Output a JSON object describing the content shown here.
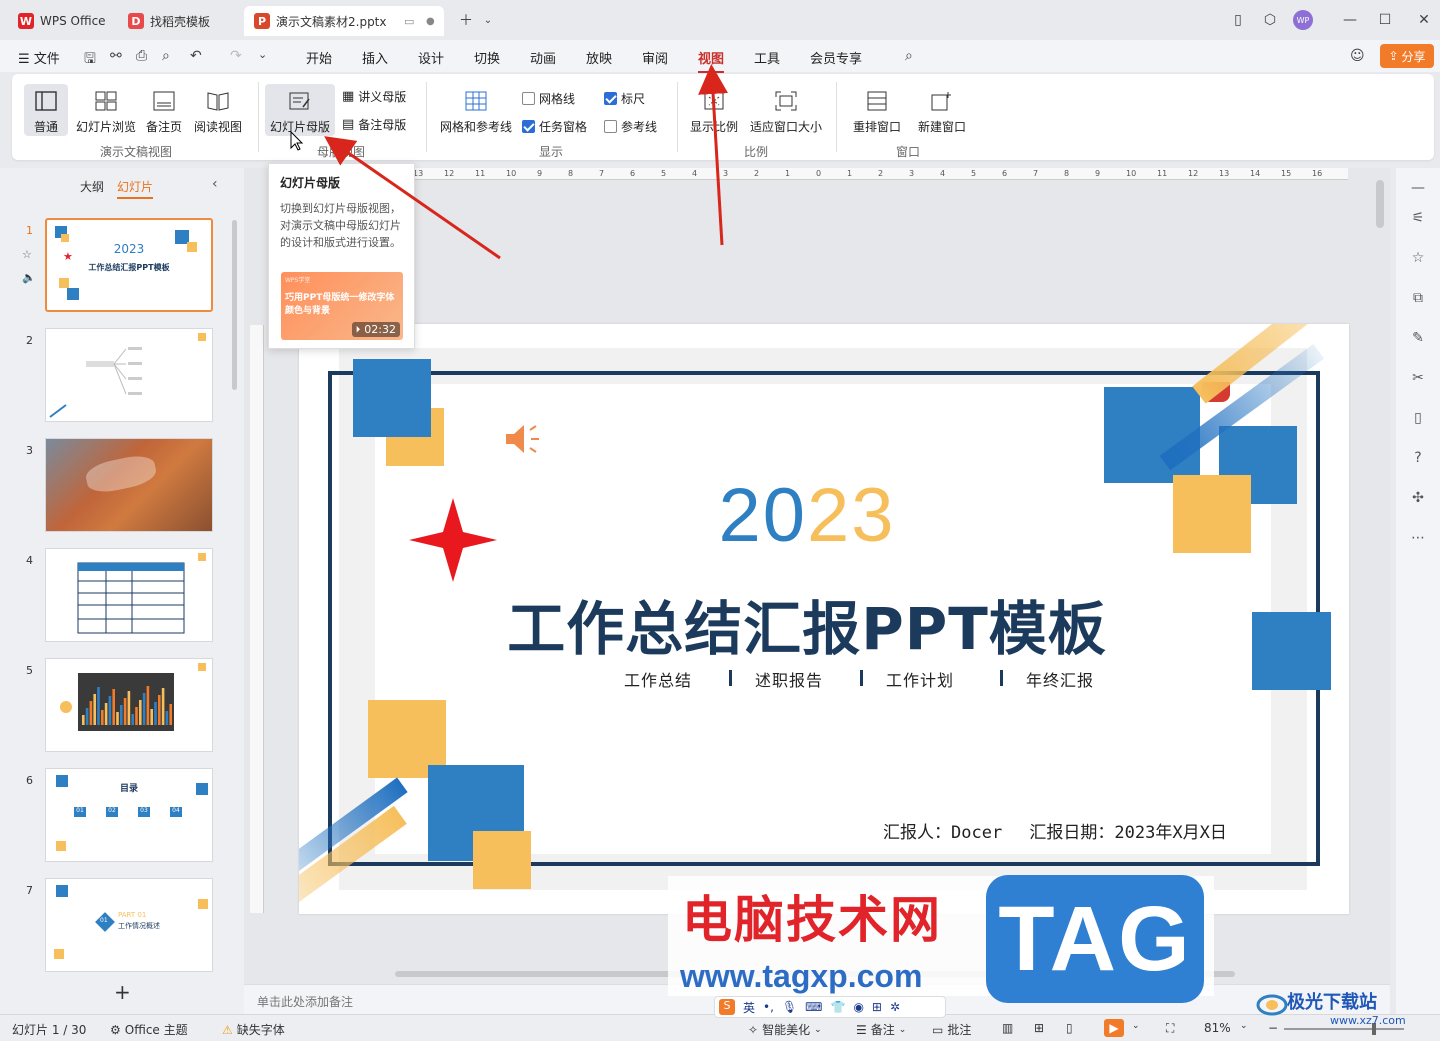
{
  "tabs": [
    {
      "label": "WPS Office",
      "logo": "W"
    },
    {
      "label": "找稻壳模板",
      "logo": "D"
    },
    {
      "label": "演示文稿素材2.pptx",
      "logo": "P"
    }
  ],
  "menu": {
    "file": "文件",
    "items": [
      "开始",
      "插入",
      "设计",
      "切换",
      "动画",
      "放映",
      "审阅",
      "视图",
      "工具",
      "会员专享"
    ],
    "active": "视图",
    "share": "分享"
  },
  "avatar": "WP",
  "ribbon": {
    "groups": {
      "presentation_views": "演示文稿视图",
      "master_views": "母版视图",
      "show": "显示",
      "zoom": "比例",
      "window": "窗口"
    },
    "buttons": {
      "normal": "普通",
      "slide_sorter": "幻灯片浏览",
      "notes_page": "备注页",
      "reading_view": "阅读视图",
      "slide_master": "幻灯片母版",
      "handout_master": "讲义母版",
      "notes_master": "备注母版",
      "grid_guides": "网格和参考线",
      "gridlines": "网格线",
      "ruler": "标尺",
      "task_pane": "任务窗格",
      "guides": "参考线",
      "zoom": "显示比例",
      "fit_window": "适应窗口大小",
      "arrange_window": "重排窗口",
      "new_window": "新建窗口"
    }
  },
  "tooltip": {
    "title": "幻灯片母版",
    "body": "切换到幻灯片母版视图，对演示文稿中母版幻灯片的设计和版式进行设置。",
    "video_brand": "WPS学堂",
    "video_title": "巧用PPT母版统一修改字体颜色与背景",
    "video_duration": "02:32"
  },
  "left_panel": {
    "tab_outline": "大纲",
    "tab_slides": "幻灯片",
    "slide_numbers": [
      "1",
      "2",
      "3",
      "4",
      "5",
      "6",
      "7"
    ],
    "thumb1_year": "2023",
    "thumb1_title": "工作总结汇报PPT模板",
    "thumb6_title": "目录",
    "thumb6_nums": [
      "01",
      "02",
      "03",
      "04"
    ],
    "thumb7_part": "PART 01",
    "thumb7_title": "工作情况概述",
    "thumb7_num": "01"
  },
  "ruler_labels": [
    "13",
    "12",
    "11",
    "10",
    "9",
    "8",
    "7",
    "6",
    "5",
    "4",
    "3",
    "2",
    "1",
    "0",
    "1",
    "2",
    "3",
    "4",
    "5",
    "6",
    "7",
    "8",
    "9",
    "10",
    "11",
    "12",
    "13",
    "14",
    "15",
    "16"
  ],
  "slide": {
    "year_a": "20",
    "year_b": "23",
    "title": "工作总结汇报PPT模板",
    "subtitles": [
      "工作总结",
      "述职报告",
      "工作计划",
      "年终汇报"
    ],
    "reporter": "汇报人：Docer　 汇报日期：2023年X月X日"
  },
  "notes_placeholder": "单击此处添加备注",
  "status": {
    "slide_counter": "幻灯片 1 / 30",
    "theme": "Office 主题",
    "missing_font": "缺失字体",
    "beautify": "智能美化",
    "notes": "备注",
    "comments": "批注",
    "zoom": "81%"
  },
  "watermark": {
    "text": "电脑技术网",
    "url": "www.tagxp.com",
    "tag": "TAG",
    "site2": "极光下载站",
    "site2_url": "www.xz7.com"
  },
  "colors": {
    "accent_red": "#c9302c",
    "blue": "#2f7fc3",
    "yellow": "#f6bf5c",
    "navy": "#1b3a5c",
    "orange": "#f27b2a"
  }
}
